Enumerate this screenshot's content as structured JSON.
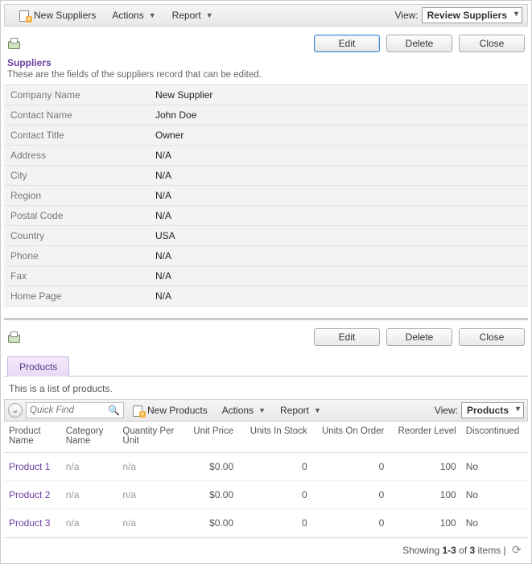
{
  "topToolbar": {
    "newSuppliers": "New Suppliers",
    "actions": "Actions",
    "report": "Report",
    "viewLabel": "View:",
    "viewSelected": "Review Suppliers"
  },
  "suppliers": {
    "editBtn": "Edit",
    "deleteBtn": "Delete",
    "closeBtn": "Close",
    "title": "Suppliers",
    "subtitle": "These are the fields of the suppliers record that can be edited.",
    "fields": [
      {
        "label": "Company Name",
        "value": "New Supplier"
      },
      {
        "label": "Contact Name",
        "value": "John Doe"
      },
      {
        "label": "Contact Title",
        "value": "Owner"
      },
      {
        "label": "Address",
        "value": "N/A"
      },
      {
        "label": "City",
        "value": "N/A"
      },
      {
        "label": "Region",
        "value": "N/A"
      },
      {
        "label": "Postal Code",
        "value": "N/A"
      },
      {
        "label": "Country",
        "value": "USA"
      },
      {
        "label": "Phone",
        "value": "N/A"
      },
      {
        "label": "Fax",
        "value": "N/A"
      },
      {
        "label": "Home Page",
        "value": "N/A"
      }
    ]
  },
  "products": {
    "editBtn": "Edit",
    "deleteBtn": "Delete",
    "closeBtn": "Close",
    "tabLabel": "Products",
    "listDesc": "This is a list of products.",
    "quickFindPlaceholder": "Quick Find",
    "newProducts": "New Products",
    "actions": "Actions",
    "report": "Report",
    "viewLabel": "View:",
    "viewSelected": "Products",
    "columns": {
      "productName": "Product Name",
      "categoryName": "Category Name",
      "qtyPerUnit": "Quantity Per Unit",
      "unitPrice": "Unit Price",
      "unitsInStock": "Units In Stock",
      "unitsOnOrder": "Units On Order",
      "reorderLevel": "Reorder Level",
      "discontinued": "Discontinued"
    },
    "rows": [
      {
        "productName": "Product 1",
        "categoryName": "n/a",
        "qtyPerUnit": "n/a",
        "unitPrice": "$0.00",
        "unitsInStock": "0",
        "unitsOnOrder": "0",
        "reorderLevel": "100",
        "discontinued": "No"
      },
      {
        "productName": "Product 2",
        "categoryName": "n/a",
        "qtyPerUnit": "n/a",
        "unitPrice": "$0.00",
        "unitsInStock": "0",
        "unitsOnOrder": "0",
        "reorderLevel": "100",
        "discontinued": "No"
      },
      {
        "productName": "Product 3",
        "categoryName": "n/a",
        "qtyPerUnit": "n/a",
        "unitPrice": "$0.00",
        "unitsInStock": "0",
        "unitsOnOrder": "0",
        "reorderLevel": "100",
        "discontinued": "No"
      }
    ],
    "footer": {
      "prefix": "Showing ",
      "range": "1-3",
      "mid": " of ",
      "total": "3",
      "suffix": " items | "
    }
  }
}
